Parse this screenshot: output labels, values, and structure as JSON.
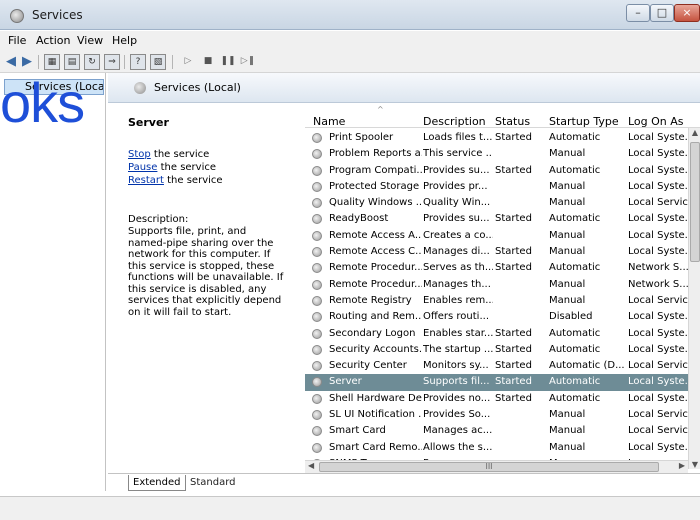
{
  "window": {
    "title": "Services"
  },
  "menubar": {
    "items": [
      "File",
      "Action",
      "View",
      "Help"
    ]
  },
  "tree": {
    "selected_label": "Services (Local)"
  },
  "pane_header": {
    "title": "Services (Local)"
  },
  "detail": {
    "service_name": "Server",
    "actions": [
      {
        "link": "Stop",
        "rest": " the service"
      },
      {
        "link": "Pause",
        "rest": " the service"
      },
      {
        "link": "Restart",
        "rest": " the service"
      }
    ],
    "description_label": "Description:",
    "description_text": "Supports file, print, and named-pipe sharing over the network for this computer. If this service is stopped, these functions will be unavailable. If this service is disabled, any services that explicitly depend on it will fail to start."
  },
  "list": {
    "columns": [
      "Name",
      "Description",
      "Status",
      "Startup Type",
      "Log On As"
    ],
    "rows": [
      [
        "Print Spooler",
        "Loads files t...",
        "Started",
        "Automatic",
        "Local Syste..."
      ],
      [
        "Problem Reports a...",
        "This service ...",
        "",
        "Manual",
        "Local Syste..."
      ],
      [
        "Program Compati...",
        "Provides su...",
        "Started",
        "Automatic",
        "Local Syste..."
      ],
      [
        "Protected Storage",
        "Provides pr...",
        "",
        "Manual",
        "Local Syste..."
      ],
      [
        "Quality Windows ...",
        "Quality Win...",
        "",
        "Manual",
        "Local Service"
      ],
      [
        "ReadyBoost",
        "Provides su...",
        "Started",
        "Automatic",
        "Local Syste..."
      ],
      [
        "Remote Access A...",
        "Creates a co...",
        "",
        "Manual",
        "Local Syste..."
      ],
      [
        "Remote Access C...",
        "Manages di...",
        "Started",
        "Manual",
        "Local Syste..."
      ],
      [
        "Remote Procedur...",
        "Serves as th...",
        "Started",
        "Automatic",
        "Network S..."
      ],
      [
        "Remote Procedur...",
        "Manages th...",
        "",
        "Manual",
        "Network S..."
      ],
      [
        "Remote Registry",
        "Enables rem...",
        "",
        "Manual",
        "Local Service"
      ],
      [
        "Routing and Rem...",
        "Offers routi...",
        "",
        "Disabled",
        "Local Syste..."
      ],
      [
        "Secondary Logon",
        "Enables star...",
        "Started",
        "Automatic",
        "Local Syste..."
      ],
      [
        "Security Accounts...",
        "The startup ...",
        "Started",
        "Automatic",
        "Local Syste..."
      ],
      [
        "Security Center",
        "Monitors sy...",
        "Started",
        "Automatic (D...",
        "Local Service"
      ],
      [
        "Server",
        "Supports fil...",
        "Started",
        "Automatic",
        "Local Syste..."
      ],
      [
        "Shell Hardware De...",
        "Provides no...",
        "Started",
        "Automatic",
        "Local Syste..."
      ],
      [
        "SL UI Notification ...",
        "Provides So...",
        "",
        "Manual",
        "Local Service"
      ],
      [
        "Smart Card",
        "Manages ac...",
        "",
        "Manual",
        "Local Service"
      ],
      [
        "Smart Card Remo...",
        "Allows the s...",
        "",
        "Manual",
        "Local Syste..."
      ],
      [
        "SNMP T...",
        "R...",
        "",
        "M...",
        "L..."
      ]
    ],
    "selected_row": "Server"
  },
  "tabs": [
    "Extended",
    "Standard"
  ],
  "watermark": {
    "text": "oks"
  },
  "colors": {
    "selected_row": "#6e8c96",
    "link": "#0033aa",
    "tree_selection": "#cde3f7"
  }
}
